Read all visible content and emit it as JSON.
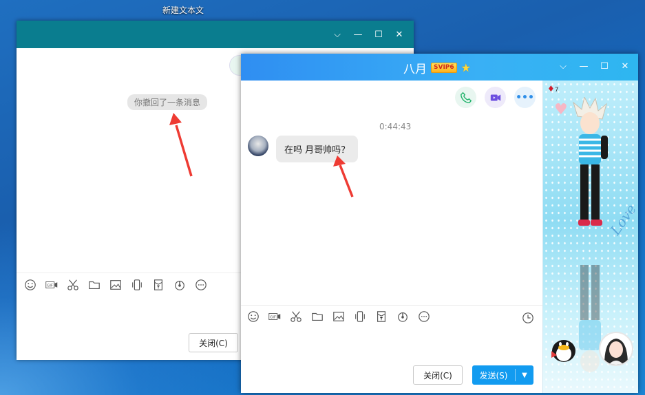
{
  "desktop": {
    "icon_label": "新建文本文"
  },
  "back_window": {
    "recall_notice": "你撤回了一条消息",
    "close_button": "关闭(C)",
    "toolbar_icons": [
      "emoji-icon",
      "gif-icon",
      "scissors-icon",
      "folder-icon",
      "image-icon",
      "shake-icon",
      "red-packet-icon",
      "music-icon",
      "more-icon"
    ]
  },
  "front_window": {
    "title": "八月",
    "vip_badge": "SVIP6",
    "timestamp": "0:44:43",
    "message": "在吗 月哥帅吗？",
    "close_button": "关闭(C)",
    "send_button": "发送(S)",
    "toolbar_icons": [
      "emoji-icon",
      "gif-icon",
      "scissors-icon",
      "folder-icon",
      "image-icon",
      "shake-icon",
      "red-packet-icon",
      "music-icon",
      "more-icon",
      "history-clock-icon"
    ],
    "show_panel": {
      "decor_text": "Love",
      "gem_count": "7"
    }
  },
  "colors": {
    "back_titlebar": "#0a7d8f",
    "front_titlebar": "#2f8ef2",
    "send_button": "#129bf0",
    "annotation_arrow": "#ee3b33"
  }
}
